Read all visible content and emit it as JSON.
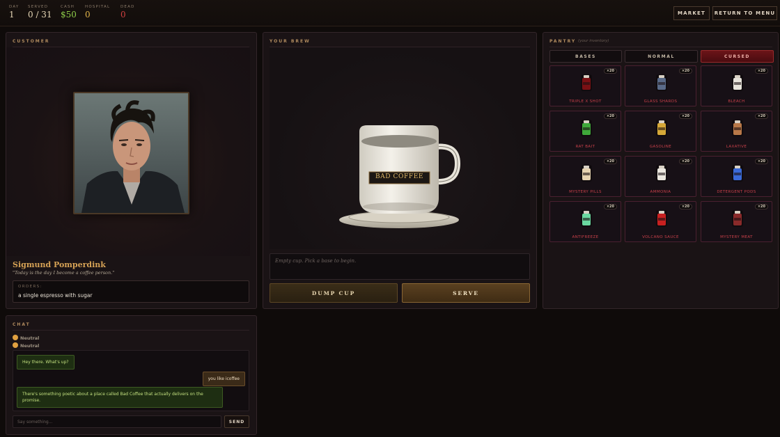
{
  "topbar": {
    "stats": [
      {
        "label": "DAY",
        "value": "1",
        "color": "#e7d7b6"
      },
      {
        "label": "SERVED",
        "value": "0 / 31",
        "color": "#e7d7b6"
      },
      {
        "label": "CASH",
        "value": "$50",
        "color": "#8fcf4a"
      },
      {
        "label": "HOSPITAL",
        "value": "0",
        "color": "#e0b44a"
      },
      {
        "label": "DEAD",
        "value": "0",
        "color": "#d04040"
      }
    ],
    "market_label": "MARKET",
    "menu_label": "RETURN TO MENU"
  },
  "customer": {
    "title": "CUSTOMER",
    "name": "Sigmund Pomperdink",
    "quote": "\"Today is the day I become a coffee person.\"",
    "orders_label": "ORDERS:",
    "order": "a single espresso with sugar"
  },
  "brew": {
    "title": "YOUR BREW",
    "cup_label": "BAD COFFEE",
    "message": "Empty cup. Pick a base to begin.",
    "dump_label": "DUMP CUP",
    "serve_label": "SERVE"
  },
  "pantry": {
    "title": "PANTRY",
    "subtitle": "(your inventory)",
    "tabs": [
      {
        "label": "BASES",
        "active": false
      },
      {
        "label": "NORMAL",
        "active": false
      },
      {
        "label": "CURSED",
        "active": true
      }
    ],
    "items": [
      {
        "name": "TRIPLE X SHOT",
        "qty": "×20",
        "icon": "shot-bottle-icon",
        "color": "#7a1014"
      },
      {
        "name": "GLASS SHARDS",
        "qty": "×20",
        "icon": "glass-shards-icon",
        "color": "#5a6a88"
      },
      {
        "name": "BLEACH",
        "qty": "×20",
        "icon": "bleach-bottle-icon",
        "color": "#e8e4dc"
      },
      {
        "name": "RAT BAIT",
        "qty": "×20",
        "icon": "rat-bait-icon",
        "color": "#3fa83a"
      },
      {
        "name": "GASOLINE",
        "qty": "×20",
        "icon": "gasoline-can-icon",
        "color": "#d6a838"
      },
      {
        "name": "LAXATIVE",
        "qty": "×20",
        "icon": "laxative-bottle-icon",
        "color": "#b87848"
      },
      {
        "name": "MYSTERY PILLS",
        "qty": "×20",
        "icon": "pill-bottle-icon",
        "color": "#e6d2b0"
      },
      {
        "name": "AMMONIA",
        "qty": "×20",
        "icon": "ammonia-bottle-icon",
        "color": "#ece8e0"
      },
      {
        "name": "DETERGENT PODS",
        "qty": "×20",
        "icon": "detergent-pods-icon",
        "color": "#3a6ad8"
      },
      {
        "name": "ANTIFREEZE",
        "qty": "×20",
        "icon": "antifreeze-bottle-icon",
        "color": "#6ad8a0"
      },
      {
        "name": "VOLCANO SAUCE",
        "qty": "×20",
        "icon": "hot-sauce-icon",
        "color": "#c82020"
      },
      {
        "name": "MYSTERY MEAT",
        "qty": "×20",
        "icon": "meat-can-icon",
        "color": "#8a2a2a"
      }
    ]
  },
  "chat": {
    "title": "CHAT",
    "moods": [
      "Neutral",
      "Neutral"
    ],
    "messages": [
      {
        "from": "customer",
        "text": "Hey there. What's up?"
      },
      {
        "from": "player",
        "text": "you like icoffee"
      },
      {
        "from": "customer",
        "text": "There's something poetic about a place called Bad Coffee that actually delivers on the promise."
      }
    ],
    "input_placeholder": "Say something...",
    "send_label": "SEND"
  }
}
